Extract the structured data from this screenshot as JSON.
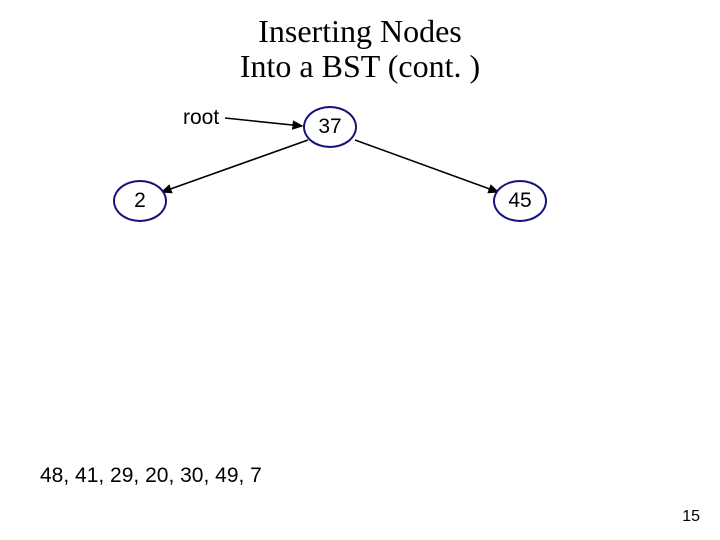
{
  "title_line1": "Inserting Nodes",
  "title_line2": "Into a BST (cont. )",
  "root_label": "root",
  "nodes": {
    "root_value": "37",
    "left_value": "2",
    "right_value": "45"
  },
  "remaining_sequence": "48, 41, 29, 20, 30, 49, 7",
  "page_number": "15"
}
